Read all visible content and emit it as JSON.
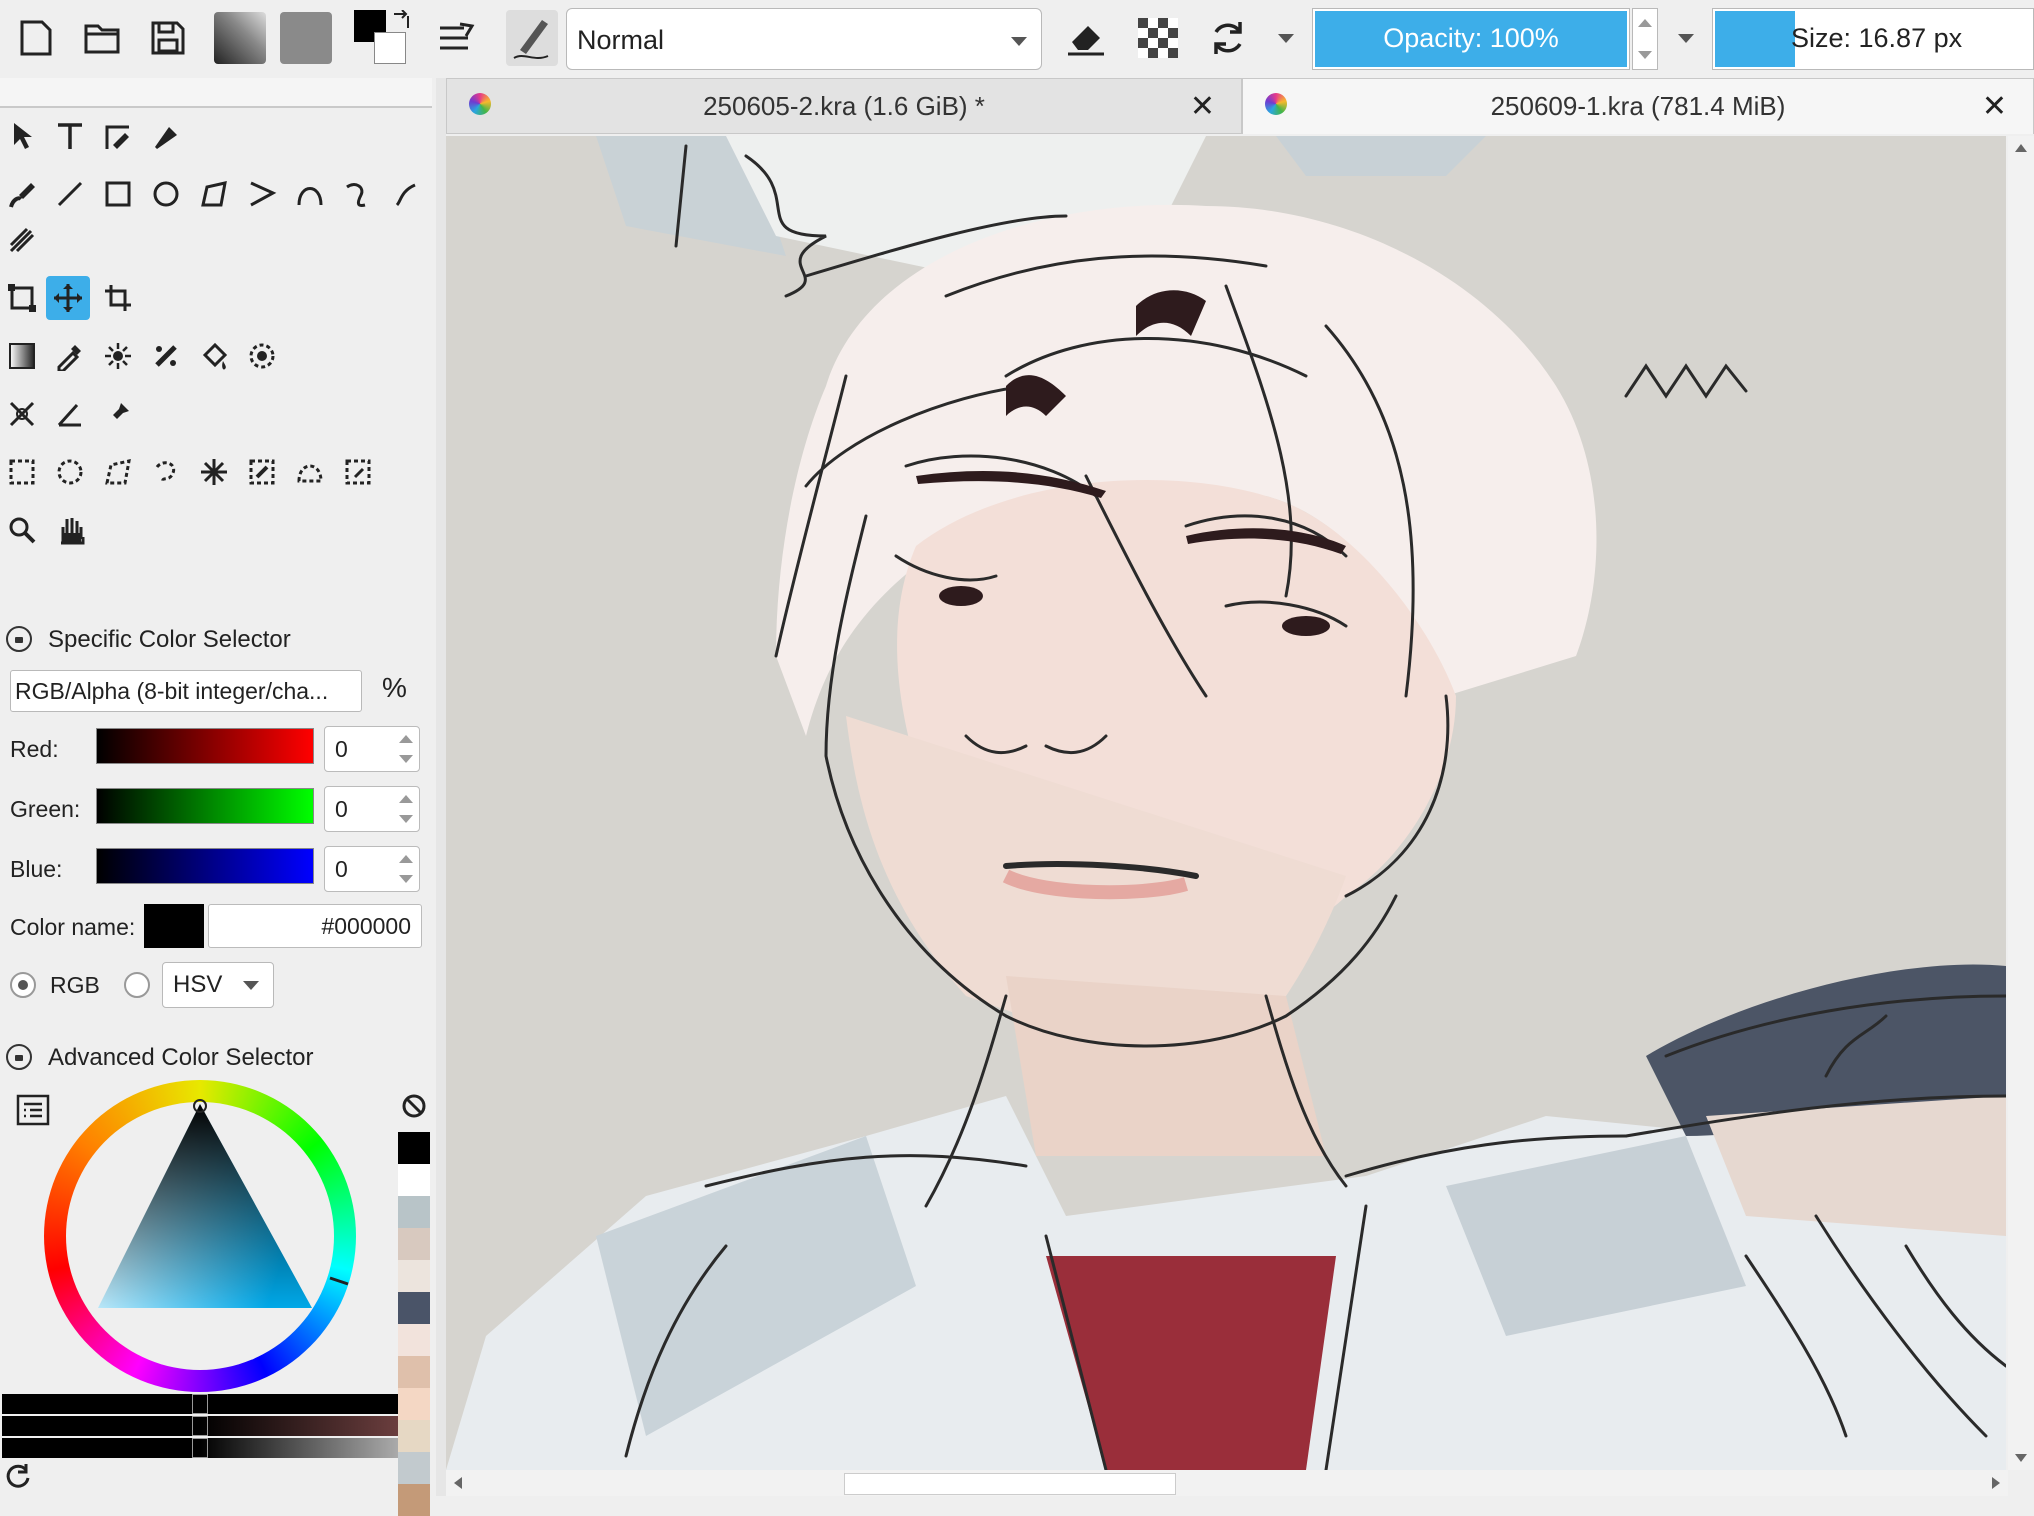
{
  "toolbar": {
    "blend_mode": "Normal",
    "opacity_label": "Opacity: 100%",
    "opacity_fraction": 1.0,
    "size_label": "Size: 16.87 px"
  },
  "tabs": [
    {
      "title": "250605-2.kra (1.6 GiB) *",
      "close": "✕"
    },
    {
      "title": "250609-1.kra (781.4 MiB)",
      "close": "✕"
    }
  ],
  "specific_color": {
    "title": "Specific Color Selector",
    "model": "RGB/Alpha (8-bit integer/cha...",
    "percent_symbol": "%",
    "red_label": "Red:",
    "green_label": "Green:",
    "blue_label": "Blue:",
    "red_value": "0",
    "green_value": "0",
    "blue_value": "0",
    "color_name_label": "Color name:",
    "color_hex": "#000000",
    "rgb_label": "RGB",
    "hsv_label": "HSV"
  },
  "advanced_color": {
    "title": "Advanced Color Selector"
  },
  "swatches": [
    "#000000",
    "#ffffff",
    "#b8c4c8",
    "#d8c9bf",
    "#ece4dd",
    "#4a5468",
    "#f2e3dc",
    "#dfc0ab",
    "#f4d7c4",
    "#e6d8c4",
    "#c2cace",
    "#c49a78"
  ],
  "colors": {
    "accent": "#3daee9",
    "canvas_bg": "#d6d4cf"
  }
}
